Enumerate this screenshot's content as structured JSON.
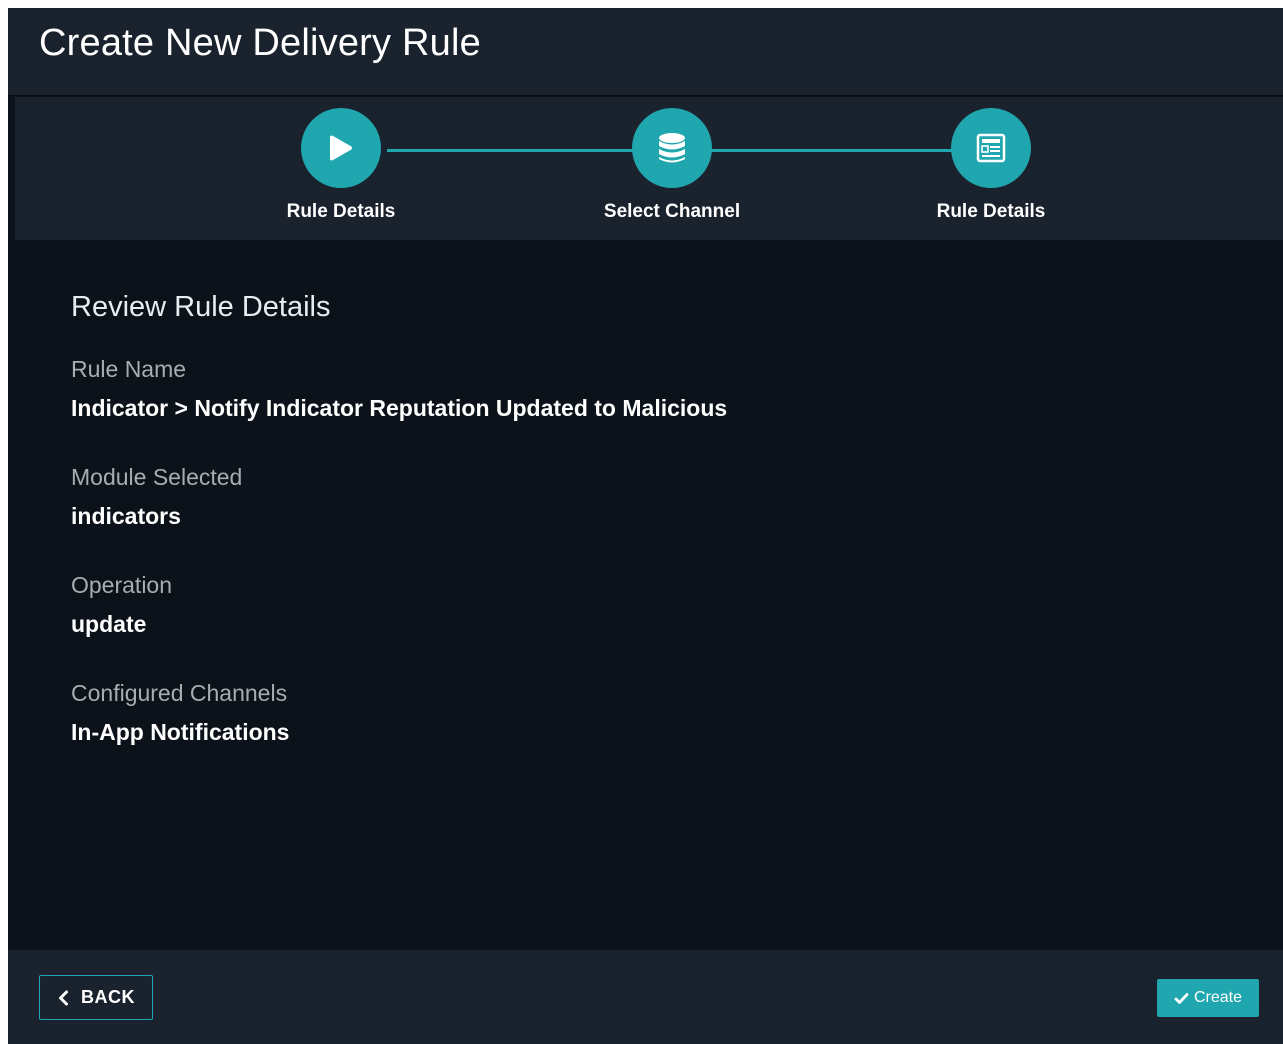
{
  "dialog": {
    "title": "Create New Delivery Rule"
  },
  "stepper": {
    "steps": [
      {
        "label": "Rule Details",
        "icon": "play-icon"
      },
      {
        "label": "Select Channel",
        "icon": "database-icon"
      },
      {
        "label": "Rule Details",
        "icon": "document-icon"
      }
    ]
  },
  "review": {
    "title": "Review Rule Details",
    "fields": [
      {
        "label": "Rule Name",
        "value": "Indicator > Notify Indicator Reputation Updated to Malicious"
      },
      {
        "label": "Module Selected",
        "value": "indicators"
      },
      {
        "label": "Operation",
        "value": "update"
      },
      {
        "label": "Configured Channels",
        "value": "In-App Notifications"
      }
    ]
  },
  "footer": {
    "back_label": "BACK",
    "back_icon": "chevron-left-icon",
    "create_label": "Create",
    "create_icon": "check-icon"
  },
  "colors": {
    "accent": "#1fa6ae",
    "panel": "#1a222d",
    "background": "#0c121a"
  }
}
